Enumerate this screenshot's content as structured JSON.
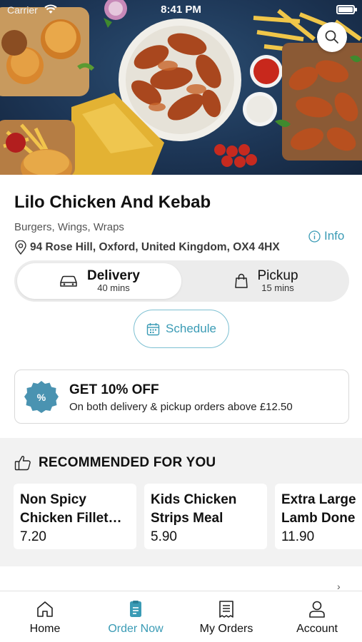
{
  "status_bar": {
    "carrier": "Carrier",
    "time": "8:41 PM"
  },
  "restaurant": {
    "name": "Lilo Chicken And Kebab",
    "cuisine": "Burgers, Wings, Wraps",
    "address": "94 Rose Hill, Oxford, United Kingdom, OX4 4HX",
    "info_label": "Info"
  },
  "order_mode": {
    "delivery": {
      "label": "Delivery",
      "time": "40 mins",
      "selected": true
    },
    "pickup": {
      "label": "Pickup",
      "time": "15 mins",
      "selected": false
    }
  },
  "schedule_label": "Schedule",
  "promo": {
    "badge_symbol": "%",
    "title": "GET 10% OFF",
    "subtitle": "On both delivery & pickup orders above £12.50"
  },
  "recommended": {
    "title": "RECOMMENDED FOR YOU",
    "items": [
      {
        "line1": "Non Spicy",
        "line2": "Chicken Fillet…",
        "price": "7.20"
      },
      {
        "line1": "Kids Chicken",
        "line2": "Strips Meal",
        "price": "5.90"
      },
      {
        "line1": "Extra Large",
        "line2": "Lamb Doner",
        "price": "11.90"
      }
    ]
  },
  "tabs": [
    {
      "label": "Home",
      "icon": "home-icon",
      "active": false
    },
    {
      "label": "Order Now",
      "icon": "order-icon",
      "active": true
    },
    {
      "label": "My Orders",
      "icon": "receipt-icon",
      "active": false
    },
    {
      "label": "Account",
      "icon": "person-icon",
      "active": false
    }
  ],
  "colors": {
    "accent": "#3a9bb5",
    "promo_badge": "#4a93b1",
    "hero_bg": "#1d3656"
  }
}
